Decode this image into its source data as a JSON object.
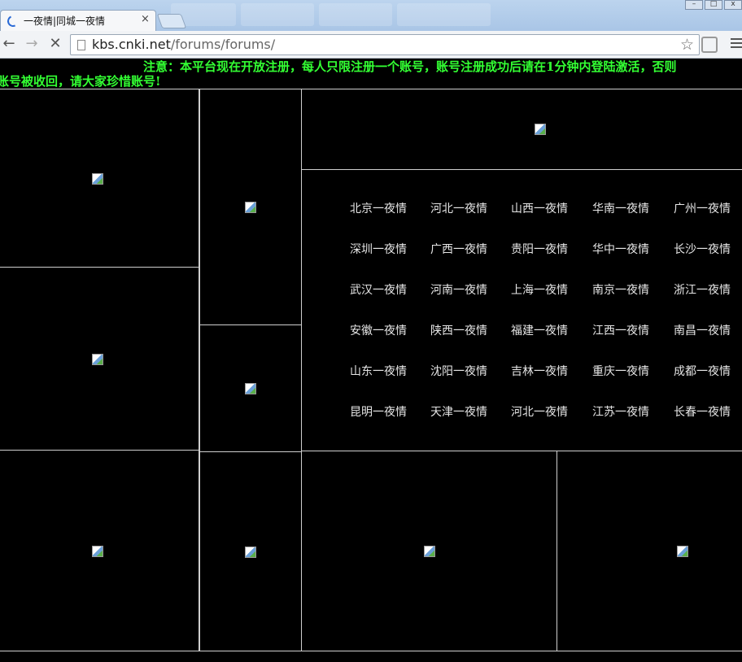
{
  "browser": {
    "tab_title": "一夜情|同城一夜情",
    "tab_close": "×",
    "url_host": "kbs.cnki.net",
    "url_path": "/forums/forums/",
    "star": "☆",
    "back": "←",
    "forward": "→",
    "stop": "✕"
  },
  "notice": {
    "line1": "注意：本平台现在开放注册，每人只限注册一个账号，账号注册成功后请在1分钟内登陆激活，否则",
    "line2": "账号被收回，请大家珍惜账号!"
  },
  "cities": [
    [
      "北京一夜情",
      "河北一夜情",
      "山西一夜情",
      "华南一夜情",
      "广州一夜情"
    ],
    [
      "深圳一夜情",
      "广西一夜情",
      "贵阳一夜情",
      "华中一夜情",
      "长沙一夜情"
    ],
    [
      "武汉一夜情",
      "河南一夜情",
      "上海一夜情",
      "南京一夜情",
      "浙江一夜情"
    ],
    [
      "安徽一夜情",
      "陕西一夜情",
      "福建一夜情",
      "江西一夜情",
      "南昌一夜情"
    ],
    [
      "山东一夜情",
      "沈阳一夜情",
      "吉林一夜情",
      "重庆一夜情",
      "成都一夜情"
    ],
    [
      "昆明一夜情",
      "天津一夜情",
      "河北一夜情",
      "江苏一夜情",
      "长春一夜情"
    ]
  ],
  "colors": {
    "notice": "#33ff33",
    "background": "#000000",
    "city_text": "#e6e6e6",
    "border": "#cfcfcf"
  }
}
